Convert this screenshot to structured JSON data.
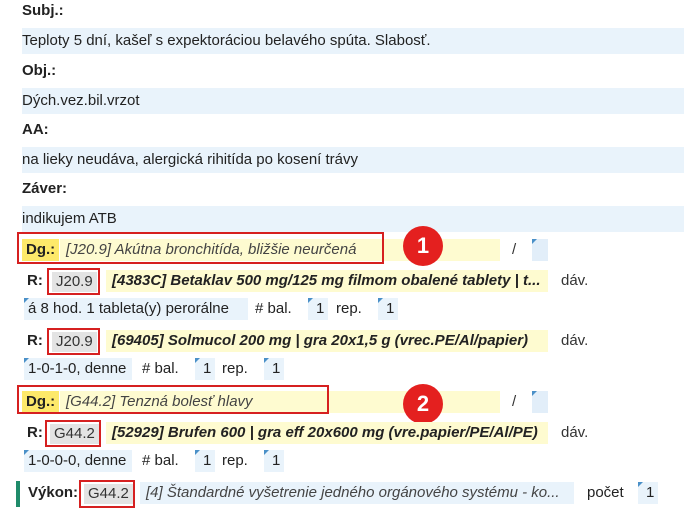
{
  "subj": {
    "label": "Subj.:",
    "text": "Teploty 5 dní, kašeľ s expektoráciou belavého spúta. Slabosť."
  },
  "obj": {
    "label": "Obj.:",
    "text": "Dých.vez.bil.vrzot"
  },
  "aa": {
    "label": "AA:",
    "text": "na lieky neudáva, alergická rihitída po kosení trávy"
  },
  "zaver": {
    "label": "Záver:",
    "text": "indikujem ATB"
  },
  "diagnoses": [
    {
      "label": "Dg.:",
      "text": "[J20.9] Akútna bronchitída, bližšie neurčená",
      "slash": "/",
      "badge": "1"
    },
    {
      "label": "Dg.:",
      "text": "[G44.2] Tenzná bolesť hlavy",
      "slash": "/",
      "badge": "2"
    }
  ],
  "prescriptions": [
    {
      "label": "R:",
      "code": "J20.9",
      "drug": "[4383C] Betaklav 500 mg/125 mg filmom obalené tablety | t...",
      "dav": "dáv.",
      "dose": "á 8 hod. 1 tableta(y) perorálne",
      "bal_label": "# bal.",
      "bal": "1",
      "rep_label": "rep.",
      "rep": "1"
    },
    {
      "label": "R:",
      "code": "J20.9",
      "drug": "[69405] Solmucol 200 mg | gra 20x1,5 g (vrec.PE/Al/papier)",
      "dav": "dáv.",
      "dose": "1-0-1-0, denne",
      "bal_label": "# bal.",
      "bal": "1",
      "rep_label": "rep.",
      "rep": "1"
    },
    {
      "label": "R:",
      "code": "G44.2",
      "drug": "[52929] Brufen 600 | gra eff 20x600 mg (vre.papier/PE/Al/PE)",
      "dav": "dáv.",
      "dose": "1-0-0-0, denne",
      "bal_label": "# bal.",
      "bal": "1",
      "rep_label": "rep.",
      "rep": "1"
    }
  ],
  "vykon": {
    "label": "Výkon:",
    "code": "G44.2",
    "text": "[4] Štandardné vyšetrenie jedného orgánového systému - ko...",
    "count_label": "počet",
    "count": "1"
  },
  "colors": {
    "highlight_yellow": "#fde96a",
    "light_yellow": "#fefbd0",
    "light_blue": "#e9f3fb",
    "annotation_red": "#e4201f",
    "accent_green": "#1f8b6a"
  }
}
